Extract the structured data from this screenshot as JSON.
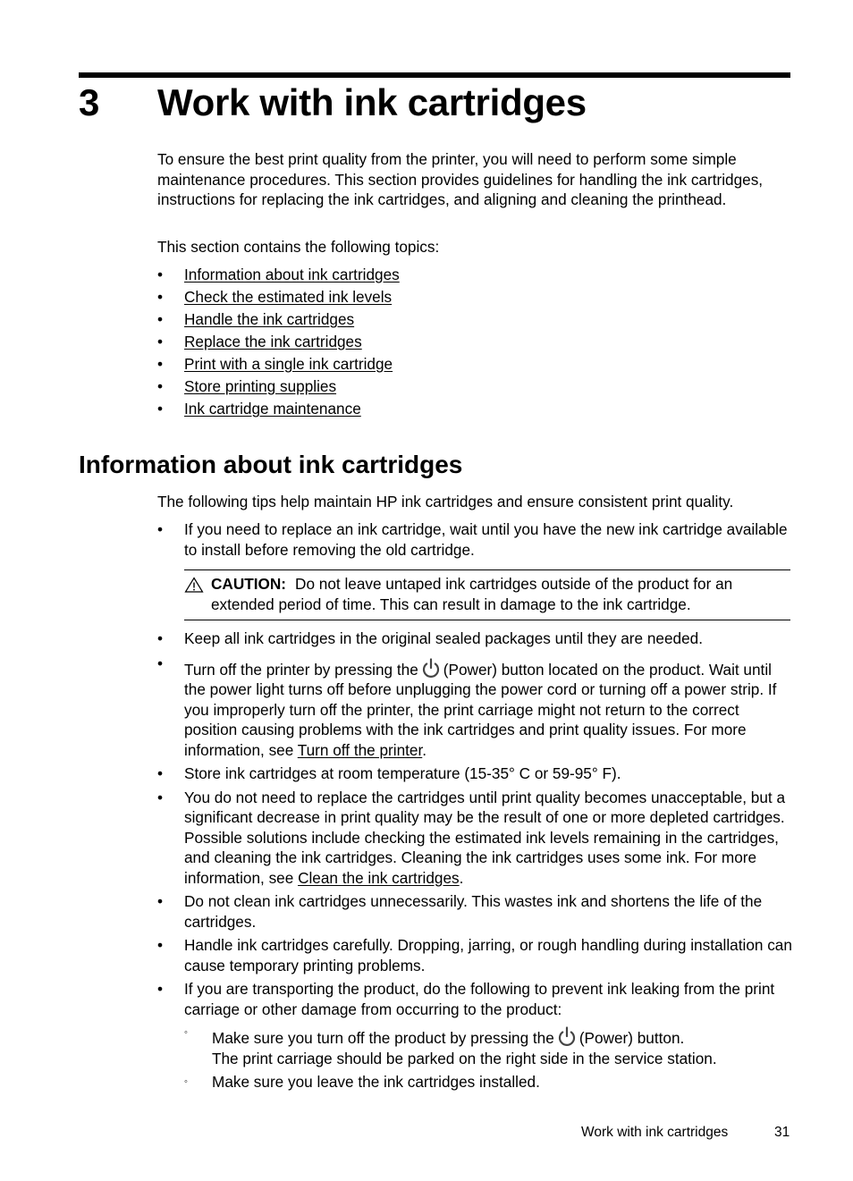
{
  "chapter": {
    "number": "3",
    "title": "Work with ink cartridges"
  },
  "intro": {
    "paragraph": "To ensure the best print quality from the printer, you will need to perform some simple maintenance procedures. This section provides guidelines for handling the ink cartridges, instructions for replacing the ink cartridges, and aligning and cleaning the printhead.",
    "topics_lead": "This section contains the following topics:",
    "bullet_glyph": "•",
    "topics": [
      {
        "label": "Information about ink cartridges"
      },
      {
        "label": "Check the estimated ink levels"
      },
      {
        "label": "Handle the ink cartridges"
      },
      {
        "label": "Replace the ink cartridges"
      },
      {
        "label": "Print with a single ink cartridge"
      },
      {
        "label": "Store printing supplies"
      },
      {
        "label": "Ink cartridge maintenance"
      }
    ]
  },
  "section": {
    "title": "Information about ink cartridges",
    "lead": "The following tips help maintain HP ink cartridges and ensure consistent print quality.",
    "tip1": "If you need to replace an ink cartridge, wait until you have the new ink cartridge available to install before removing the old cartridge.",
    "caution": {
      "icon": "warning-triangle-icon",
      "label": "CAUTION:",
      "text": "Do not leave untaped ink cartridges outside of the product for an extended period of time. This can result in damage to the ink cartridge."
    },
    "tip2": "Keep all ink cartridges in the original sealed packages until they are needed.",
    "tip3": {
      "before_icon": "Turn off the printer by pressing the",
      "icon": "power-icon",
      "after_icon": "(Power) button located on the product. Wait until the power light turns off before unplugging the power cord or turning off a power strip. If you improperly turn off the printer, the print carriage might not return to the correct position causing problems with the ink cartridges and print quality issues. For more information, see",
      "link": "Turn off the printer",
      "end": "."
    },
    "tip4": "Store ink cartridges at room temperature (15-35° C or 59-95° F).",
    "tip5": {
      "text": "You do not need to replace the cartridges until print quality becomes unacceptable, but a significant decrease in print quality may be the result of one or more depleted cartridges. Possible solutions include checking the estimated ink levels remaining in the cartridges, and cleaning the ink cartridges. Cleaning the ink cartridges uses some ink. For more information, see",
      "link": "Clean the ink cartridges",
      "end": "."
    },
    "tip6": "Do not clean ink cartridges unnecessarily. This wastes ink and shortens the life of the cartridges.",
    "tip7": "Handle ink cartridges carefully. Dropping, jarring, or rough handling during installation can cause temporary printing problems.",
    "tip8": "If you are transporting the product, do the following to prevent ink leaking from the print carriage or other damage from occurring to the product:",
    "sub_bullet_glyph": "◦",
    "sub1": {
      "before_icon": "Make sure you turn off the product by pressing the",
      "icon": "power-icon",
      "after_icon": "(Power) button.",
      "line2": "The print carriage should be parked on the right side in the service station."
    },
    "sub2": "Make sure you leave the ink cartridges installed."
  },
  "footer": {
    "chapter_name": "Work with ink cartridges",
    "page_number": "31"
  }
}
